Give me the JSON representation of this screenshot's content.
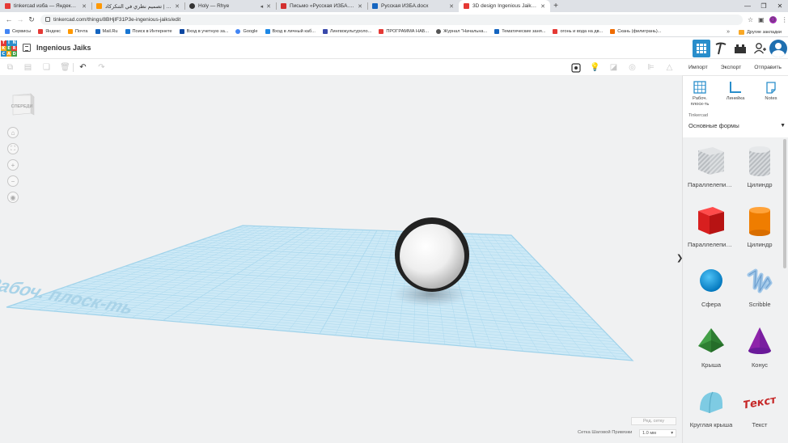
{
  "browser": {
    "tabs": [
      {
        "title": "tinkercad изба — Яндекс: нашл...",
        "color": "#e53935",
        "active": false
      },
      {
        "title": "تصميم نظري في التنكركاد | Inspire",
        "color": "#ff9800",
        "active": false
      },
      {
        "title": "Holy — Rhye",
        "color": "#333333",
        "active": false
      },
      {
        "title": "Письмо «Русская ИЗБА.docx» - ...",
        "color": "#d32f2f",
        "active": false
      },
      {
        "title": "Русская ИЗБА.docx",
        "color": "#1565c0",
        "active": false
      },
      {
        "title": "3D design Ingenious Jaiks | Tink...",
        "color": "#e53935",
        "active": true
      }
    ],
    "new_tab": "+",
    "url": "tinkercad.com/things/8BHjlF31P3e-ingenious-jaiks/edit",
    "profile_initial": "O",
    "bookmarks": [
      {
        "label": "Сервисы",
        "color": "#4285f4"
      },
      {
        "label": "Яндекс",
        "color": "#e53935"
      },
      {
        "label": "Почта",
        "color": "#ff9800"
      },
      {
        "label": "Mail.Ru",
        "color": "#1565c0"
      },
      {
        "label": "Поиск в Интернете",
        "color": "#1976d2"
      },
      {
        "label": "Вход в учетную за...",
        "color": "#0d47a1"
      },
      {
        "label": "Google",
        "color": "#4285f4"
      },
      {
        "label": "Вход в личный каб...",
        "color": "#1e88e5"
      },
      {
        "label": "Лингвокультуроло...",
        "color": "#3949ab"
      },
      {
        "label": "ПРОГРАММА НАБ...",
        "color": "#e53935"
      },
      {
        "label": "Журнал \"Начальна...",
        "color": "#555555"
      },
      {
        "label": "Тематические заня...",
        "color": "#1565c0"
      },
      {
        "label": "огонь и вода на дв...",
        "color": "#e53935"
      },
      {
        "label": "Скань (филигрань)...",
        "color": "#ef6c00"
      }
    ],
    "bookmarks_more": "»",
    "other_bookmarks": "Другие закладки"
  },
  "app": {
    "logo_letters": [
      "TIN",
      "KER",
      "CAD"
    ],
    "design_title": "Ingenious Jaiks",
    "import_label": "Импорт",
    "export_label": "Экспорт",
    "send_label": "Отправить"
  },
  "workspace": {
    "viewcube_label": "СПЕРЕДИ",
    "workplane_text": "Рабоч. плоск-ть",
    "edit_grid_label": "Ред. сетку",
    "snap_label": "Сетка Шаговой Привязки",
    "snap_value": "1.0 мм",
    "collapse_arrow": "❯"
  },
  "panel": {
    "tools": [
      {
        "label": "Рабоч. плоск-ть"
      },
      {
        "label": "Линейка"
      },
      {
        "label": "Notes"
      }
    ],
    "library_source": "Tinkercad",
    "category": "Основные формы",
    "shapes": [
      {
        "label": "Параллелепипед",
        "icon": "box-hole-icon"
      },
      {
        "label": "Цилиндр",
        "icon": "cylinder-hole-icon"
      },
      {
        "label": "Параллелепипед",
        "icon": "box-red-icon"
      },
      {
        "label": "Цилиндр",
        "icon": "cylinder-orange-icon"
      },
      {
        "label": "Сфера",
        "icon": "sphere-blue-icon"
      },
      {
        "label": "Scribble",
        "icon": "scribble-icon"
      },
      {
        "label": "Крыша",
        "icon": "roof-green-icon"
      },
      {
        "label": "Конус",
        "icon": "cone-purple-icon"
      },
      {
        "label": "Круглая крыша",
        "icon": "round-roof-icon"
      },
      {
        "label": "Текст",
        "icon": "text-shape-icon"
      }
    ]
  },
  "colors": {
    "accent_blue": "#2a8ecb",
    "workplane": "#cde9f6",
    "workplane_line": "#9fd2ea"
  }
}
